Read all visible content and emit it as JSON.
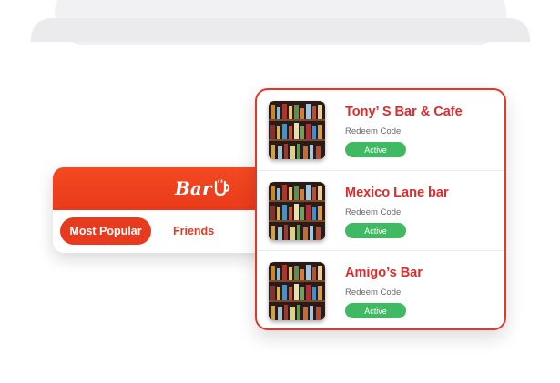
{
  "app": {
    "logo_text": "Bar",
    "tabs": [
      {
        "label": "Most Popular",
        "active": true
      },
      {
        "label": "Friends",
        "active": false
      }
    ]
  },
  "bars": [
    {
      "name": "Tony’ S Bar & Cafe",
      "subtitle": "Redeem Code",
      "status": "Active"
    },
    {
      "name": "Mexico Lane bar",
      "subtitle": "Redeem Code",
      "status": "Active"
    },
    {
      "name": "Amigo’s Bar",
      "subtitle": "Redeem Code",
      "status": "Active"
    }
  ],
  "colors": {
    "brand_red": "#e83a1f",
    "status_green": "#3fba62",
    "card_border": "#e5362a"
  }
}
